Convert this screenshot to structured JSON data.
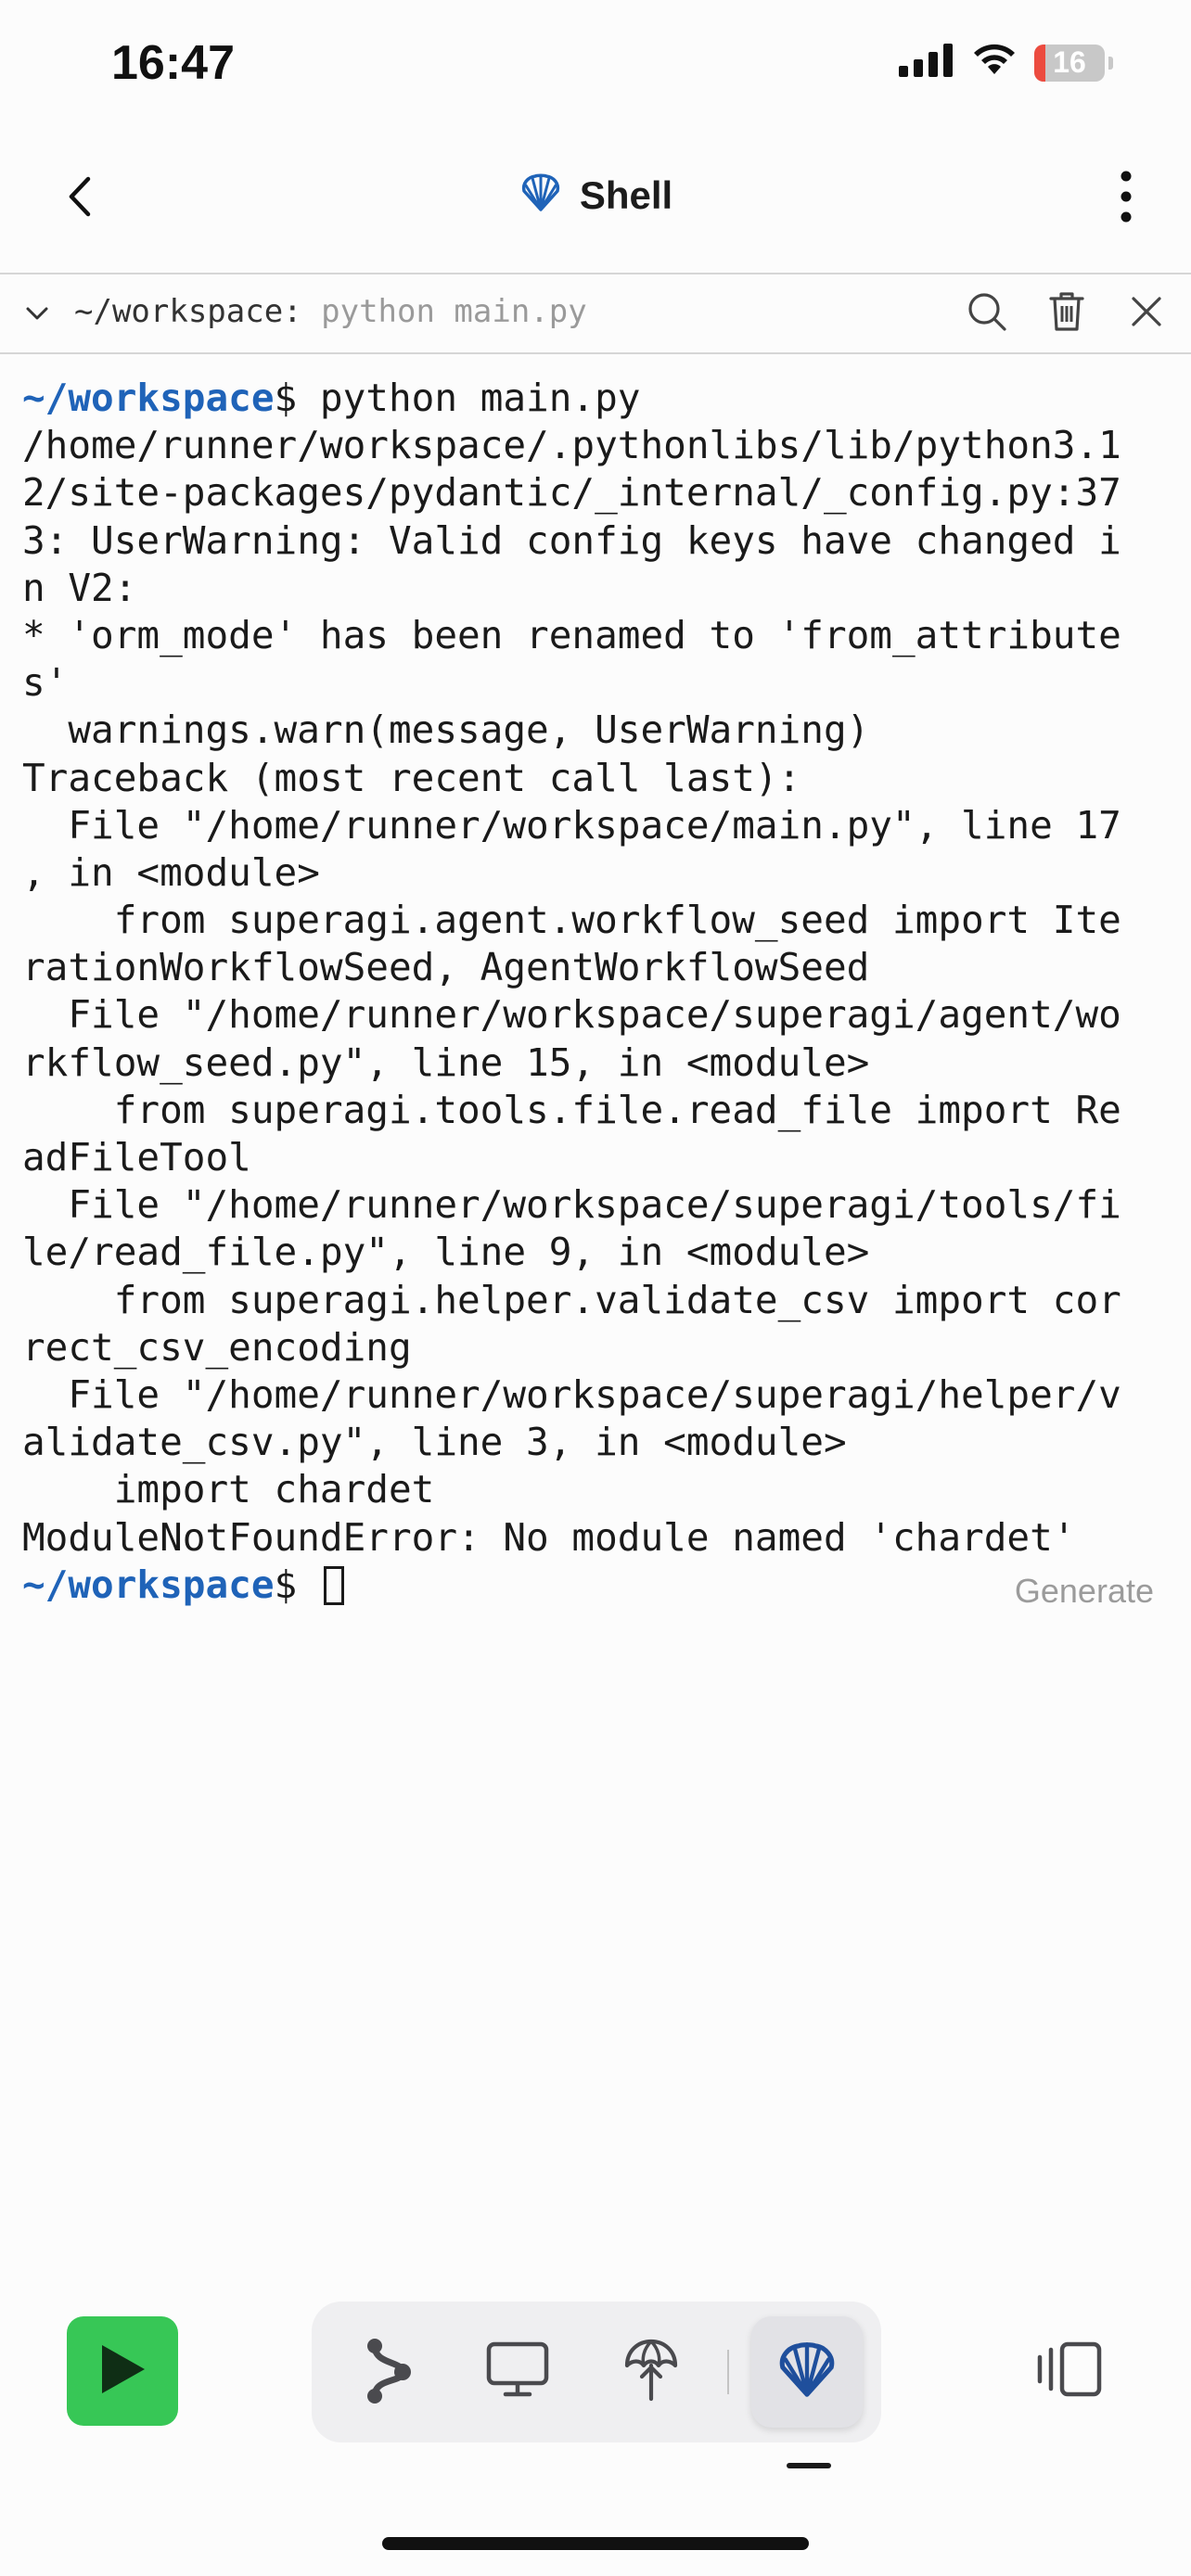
{
  "status_bar": {
    "time": "16:47",
    "battery_level": "16",
    "battery_fraction": 0.16,
    "battery_color": "#ec4b3f"
  },
  "header": {
    "title": "Shell",
    "back_icon": "chevron-left-icon",
    "menu_icon": "vertical-ellipsis-icon",
    "title_icon": "shell-icon",
    "title_icon_color": "#1f63b8"
  },
  "command_bar": {
    "directory": "~/workspace:",
    "command": "python main.py",
    "actions": [
      "search-icon",
      "trash-icon",
      "close-icon"
    ]
  },
  "terminal": {
    "prompt_dir": "~/workspace",
    "prompt_symbol": "$",
    "first_command": " python main.py",
    "output_lines": [
      "/home/runner/workspace/.pythonlibs/lib/python3.1",
      "2/site-packages/pydantic/_internal/_config.py:37",
      "3: UserWarning: Valid config keys have changed i",
      "n V2:",
      "* 'orm_mode' has been renamed to 'from_attribute",
      "s'",
      "  warnings.warn(message, UserWarning)",
      "Traceback (most recent call last):",
      "  File \"/home/runner/workspace/main.py\", line 17",
      ", in <module>",
      "    from superagi.agent.workflow_seed import Ite",
      "rationWorkflowSeed, AgentWorkflowSeed",
      "  File \"/home/runner/workspace/superagi/agent/wo",
      "rkflow_seed.py\", line 15, in <module>",
      "    from superagi.tools.file.read_file import Re",
      "adFileTool",
      "  File \"/home/runner/workspace/superagi/tools/fi",
      "le/read_file.py\", line 9, in <module>",
      "    from superagi.helper.validate_csv import cor",
      "rect_csv_encoding",
      "  File \"/home/runner/workspace/superagi/helper/v",
      "alidate_csv.py\", line 3, in <module>",
      "    import chardet",
      "ModuleNotFoundError: No module named 'chardet'"
    ],
    "generate_label": "Generate"
  },
  "toolbar": {
    "run_icon": "play-icon",
    "run_color": "#37c756",
    "tools": [
      "git-branch-icon",
      "monitor-icon",
      "deploy-umbrella-icon"
    ],
    "active_tool": "shell-icon",
    "panels_icon": "panels-icon"
  }
}
